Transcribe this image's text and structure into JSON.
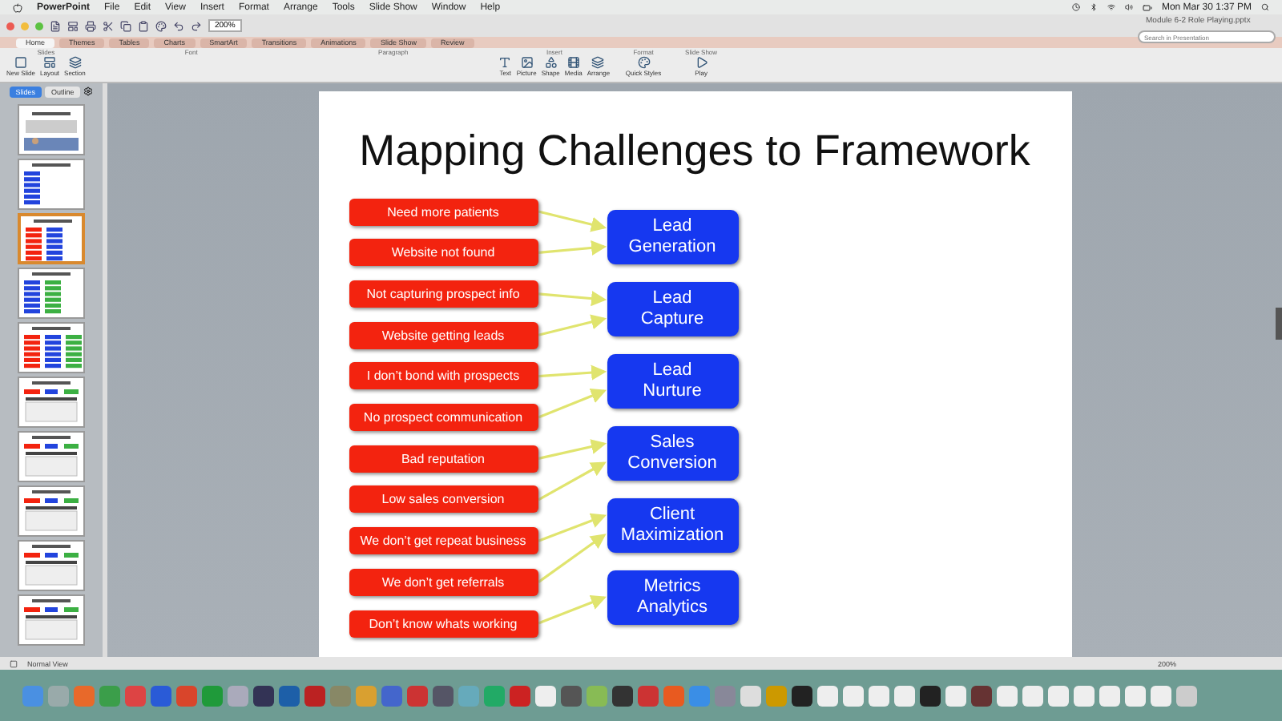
{
  "menu_bar": {
    "app": "PowerPoint",
    "menus": [
      "File",
      "Edit",
      "View",
      "Insert",
      "Format",
      "Arrange",
      "Tools",
      "Slide Show",
      "Window",
      "Help"
    ],
    "clock": "Mon Mar 30  1:37 PM"
  },
  "window": {
    "title": "Module 6-2 Role Playing.pptx",
    "zoom": "200%",
    "search": {
      "placeholder": "Search in Presentation"
    }
  },
  "ribbon_tabs": [
    {
      "label": "Home",
      "selected": true
    },
    {
      "label": "Themes",
      "selected": false
    },
    {
      "label": "Tables",
      "selected": false
    },
    {
      "label": "Charts",
      "selected": false
    },
    {
      "label": "SmartArt",
      "selected": false
    },
    {
      "label": "Transitions",
      "selected": false
    },
    {
      "label": "Animations",
      "selected": false
    },
    {
      "label": "Slide Show",
      "selected": false
    },
    {
      "label": "Review",
      "selected": false
    }
  ],
  "ribbon_groups": [
    {
      "title": "Slides",
      "buttons": [
        "New Slide",
        "Layout",
        "Section"
      ]
    },
    {
      "title": "Font"
    },
    {
      "title": "Paragraph"
    },
    {
      "title": "Insert",
      "buttons": [
        "Text",
        "Picture",
        "Shape",
        "Media",
        "Arrange"
      ]
    },
    {
      "title": "Format",
      "buttons": [
        "Quick Styles"
      ]
    },
    {
      "title": "Slide Show",
      "buttons": [
        "Play"
      ]
    }
  ],
  "pane_tabs": [
    {
      "label": "Slides",
      "selected": true
    },
    {
      "label": "Outline",
      "selected": false
    }
  ],
  "thumbnails": [
    {
      "kind": "photo",
      "selected": false
    },
    {
      "kind": "blue",
      "selected": false
    },
    {
      "kind": "redblue",
      "selected": true
    },
    {
      "kind": "bluegreen",
      "selected": false
    },
    {
      "kind": "redbluegreen",
      "selected": false
    },
    {
      "kind": "table",
      "selected": false
    },
    {
      "kind": "table",
      "selected": false
    },
    {
      "kind": "table",
      "selected": false
    },
    {
      "kind": "table",
      "selected": false
    },
    {
      "kind": "table",
      "selected": false
    }
  ],
  "slide": {
    "title": "Mapping Challenges to Framework",
    "groups": [
      {
        "challenges": [
          "Need more patients",
          "Website not found"
        ],
        "framework": [
          "Lead",
          "Generation"
        ]
      },
      {
        "challenges": [
          "Not capturing prospect info",
          "Website getting leads"
        ],
        "framework": [
          "Lead",
          "Capture"
        ]
      },
      {
        "challenges": [
          "I don’t bond with prospects",
          "No prospect communication"
        ],
        "framework": [
          "Lead",
          "Nurture"
        ]
      },
      {
        "challenges": [
          "Bad reputation",
          "Low sales conversion"
        ],
        "framework": [
          "Sales",
          "Conversion"
        ]
      },
      {
        "challenges": [
          "We don’t get repeat business",
          "We don’t get referrals"
        ],
        "framework": [
          "Client",
          "Maximization"
        ]
      },
      {
        "challenges": [
          "Don’t know whats working"
        ],
        "framework": [
          "Metrics",
          "Analytics"
        ]
      }
    ]
  },
  "status_bar": {
    "view": "Normal View",
    "zoom": "200%"
  }
}
